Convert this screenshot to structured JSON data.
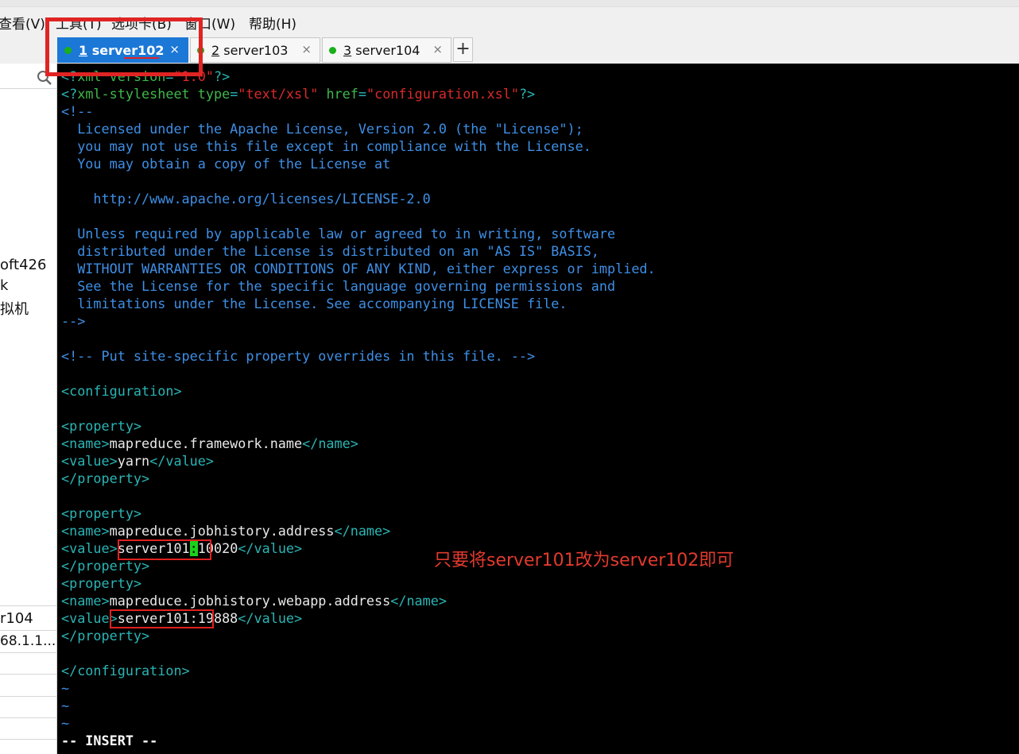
{
  "menu": {
    "items": [
      "查看(V)",
      "工具(T)",
      "选项卡(B)",
      "窗口(W)",
      "帮助(H)"
    ]
  },
  "tabs": [
    {
      "num": "1",
      "name": "server102",
      "close": "×",
      "active": true
    },
    {
      "num": "2",
      "name": "server103",
      "close": "×",
      "active": false
    },
    {
      "num": "3",
      "name": "server104",
      "close": "×",
      "active": false
    }
  ],
  "tab_add": "+",
  "left_pane": {
    "pin": "ᛘ",
    "close": "✕",
    "items": [
      "oft426",
      "k",
      "拟机",
      "r104",
      "68.1.1..."
    ]
  },
  "editor": {
    "lines": [
      "<?xml version=\"1.0\"?>",
      "<?xml-stylesheet type=\"text/xsl\" href=\"configuration.xsl\"?>",
      "<!--",
      "  Licensed under the Apache License, Version 2.0 (the \"License\");",
      "  you may not use this file except in compliance with the License.",
      "  You may obtain a copy of the License at",
      "",
      "    http://www.apache.org/licenses/LICENSE-2.0",
      "",
      "  Unless required by applicable law or agreed to in writing, software",
      "  distributed under the License is distributed on an \"AS IS\" BASIS,",
      "  WITHOUT WARRANTIES OR CONDITIONS OF ANY KIND, either express or implied.",
      "  See the License for the specific language governing permissions and",
      "  limitations under the License. See accompanying LICENSE file.",
      "-->",
      "",
      "<!-- Put site-specific property overrides in this file. -->",
      "",
      "<configuration>",
      "",
      "<property>",
      "<name>mapreduce.framework.name</name>",
      "<value>yarn</value>",
      "</property>",
      "",
      "<property>",
      "<name>mapreduce.jobhistory.address</name>",
      "<value>server101:10020</value>",
      "</property>",
      "<property>",
      "<name>mapreduce.jobhistory.webapp.address</name>",
      "<value>server101:19888</value>",
      "</property>",
      "",
      "</configuration>",
      "~",
      "~",
      "~"
    ],
    "status": "-- INSERT --"
  },
  "annotation": "只要将server101改为server102即可",
  "colors": {
    "tab_active": "#1b78d6",
    "terminal_bg": "#000000",
    "comment": "#3e8fe6",
    "tag": "#2bb4b4",
    "string": "#d72a2a",
    "attr": "#3fb84a",
    "cursor": "#19d219",
    "annotation_red": "#e02020"
  }
}
